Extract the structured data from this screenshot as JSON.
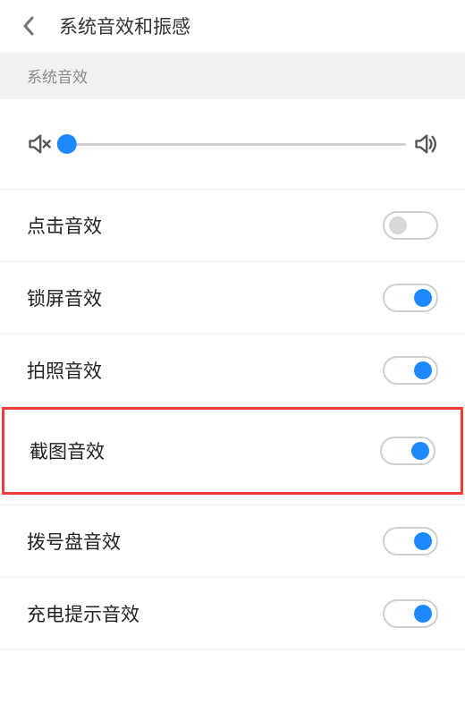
{
  "header": {
    "title": "系统音效和振感"
  },
  "section": {
    "title": "系统音效"
  },
  "slider": {
    "value": 0
  },
  "settings": {
    "tap": {
      "label": "点击音效",
      "enabled": false
    },
    "lock": {
      "label": "锁屏音效",
      "enabled": true
    },
    "camera": {
      "label": "拍照音效",
      "enabled": true
    },
    "screenshot": {
      "label": "截图音效",
      "enabled": true,
      "highlighted": true
    },
    "dialpad": {
      "label": "拨号盘音效",
      "enabled": true
    },
    "charging": {
      "label": "充电提示音效",
      "enabled": true
    }
  }
}
